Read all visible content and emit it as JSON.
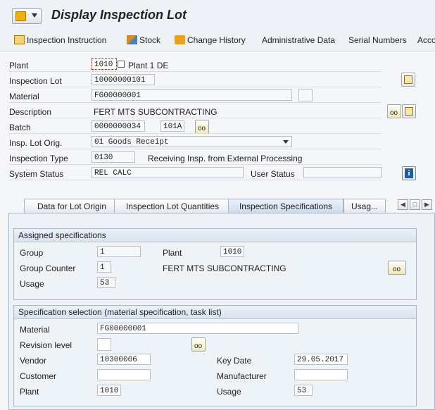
{
  "window": {
    "title": "Display Inspection Lot"
  },
  "toolbar": {
    "items": [
      {
        "label": "Inspection Instruction"
      },
      {
        "label": "Stock"
      },
      {
        "label": "Change History"
      },
      {
        "label": "Administrative Data"
      },
      {
        "label": "Serial Numbers"
      },
      {
        "label": "Acco"
      }
    ]
  },
  "header": {
    "plant": {
      "label": "Plant",
      "value": "1010",
      "text": "Plant 1 DE"
    },
    "inspection_lot": {
      "label": "Inspection Lot",
      "value": "10000000101"
    },
    "material": {
      "label": "Material",
      "value": "FG00000001"
    },
    "description": {
      "label": "Description",
      "text": "FERT MTS SUBCONTRACTING"
    },
    "batch": {
      "label": "Batch",
      "value": "0000000034",
      "value2": "101A"
    },
    "lot_origin": {
      "label": "Insp. Lot Orig.",
      "value": "01 Goods Receipt"
    },
    "inspection_type": {
      "label": "Inspection Type",
      "value": "0130",
      "text": "Receiving Insp. from External Processing"
    },
    "system_status": {
      "label": "System Status",
      "value": "REL  CALC"
    },
    "user_status": {
      "label": "User Status",
      "value": ""
    }
  },
  "tabs": [
    {
      "label": "Data for Lot Origin"
    },
    {
      "label": "Inspection Lot Quantities"
    },
    {
      "label": "Inspection Specifications",
      "active": true
    },
    {
      "label": "Usag..."
    }
  ],
  "assigned": {
    "title": "Assigned specifications",
    "group": {
      "label": "Group",
      "value": "1"
    },
    "plant": {
      "label": "Plant",
      "value": "1010"
    },
    "group_counter": {
      "label": "Group Counter",
      "value": "1",
      "text": "FERT MTS SUBCONTRACTING"
    },
    "usage": {
      "label": "Usage",
      "value": "53"
    }
  },
  "selection": {
    "title": "Specification selection (material specification, task list)",
    "material": {
      "label": "Material",
      "value": "FG00000001"
    },
    "revision": {
      "label": "Revision level",
      "value": ""
    },
    "vendor": {
      "label": "Vendor",
      "value": "10300006"
    },
    "key_date": {
      "label": "Key Date",
      "value": "29.05.2017"
    },
    "customer": {
      "label": "Customer",
      "value": ""
    },
    "manufacturer": {
      "label": "Manufacturer",
      "value": ""
    },
    "plant": {
      "label": "Plant",
      "value": "1010"
    },
    "usage": {
      "label": "Usage",
      "value": "53"
    }
  },
  "colors": {
    "accent": "#1b5ea8",
    "panel": "#eef3f8"
  }
}
